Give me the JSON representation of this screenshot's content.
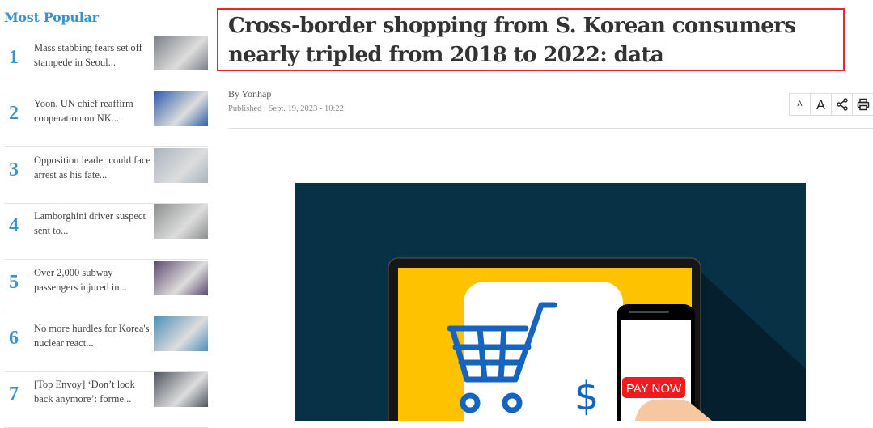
{
  "sidebar": {
    "title": "Most Popular",
    "items": [
      {
        "rank": "1",
        "headline": "Mass stabbing fears set off stampede in Seoul...",
        "thumb_color": "#7a7f86"
      },
      {
        "rank": "2",
        "headline": "Yoon, UN chief reaffirm cooperation on NK...",
        "thumb_color": "#2d5ea8"
      },
      {
        "rank": "3",
        "headline": "Opposition leader could face arrest as his fate...",
        "thumb_color": "#a9b3bd"
      },
      {
        "rank": "4",
        "headline": "Lamborghini driver suspect sent to...",
        "thumb_color": "#8c8f8f"
      },
      {
        "rank": "5",
        "headline": "Over 2,000 subway passengers injured in...",
        "thumb_color": "#5a4a6e"
      },
      {
        "rank": "6",
        "headline": "No more hurdles for Korea's nuclear react...",
        "thumb_color": "#4b90b8"
      },
      {
        "rank": "7",
        "headline": "[Top Envoy] ‘Don’t look back anymore’: forme...",
        "thumb_color": "#4e5460"
      }
    ]
  },
  "article": {
    "title": "Cross-border shopping from S. Korean consumers nearly tripled from 2018 to 2022: data",
    "byline": "By Yonhap",
    "published": "Published : Sept. 19, 2023 - 10:22",
    "tools": {
      "font_small": "A",
      "font_large": "A",
      "share_icon": "share-icon",
      "print_icon": "print-icon"
    },
    "image": {
      "button_text": "PAY NOW",
      "dollar": "$"
    }
  },
  "colors": {
    "accent": "#3a93cf",
    "highlight_border": "#e8262b",
    "hero_bg": "#083146",
    "screen": "#ffc200",
    "cart": "#1565c0",
    "pay_button": "#f4191c"
  }
}
